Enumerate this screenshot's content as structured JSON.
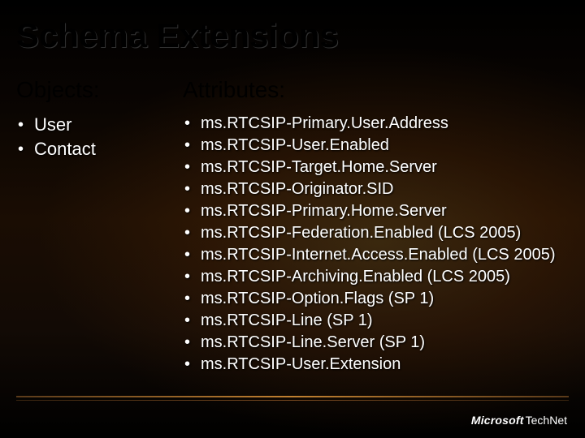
{
  "title": "Schema Extensions",
  "objects": {
    "heading": "Objects:",
    "items": [
      "User",
      "Contact"
    ]
  },
  "attributes": {
    "heading": "Attributes:",
    "items": [
      "ms.RTCSIP-Primary.User.Address",
      "ms.RTCSIP-User.Enabled",
      "ms.RTCSIP-Target.Home.Server",
      "ms.RTCSIP-Originator.SID",
      "ms.RTCSIP-Primary.Home.Server",
      "ms.RTCSIP-Federation.Enabled (LCS 2005)",
      "ms.RTCSIP-Internet.Access.Enabled (LCS 2005)",
      "ms.RTCSIP-Archiving.Enabled (LCS 2005)",
      "ms.RTCSIP-Option.Flags (SP 1)",
      "ms.RTCSIP-Line (SP 1)",
      "ms.RTCSIP-Line.Server (SP 1)",
      "ms.RTCSIP-User.Extension"
    ]
  },
  "footer": {
    "brand": "Microsoft",
    "sub": "TechNet"
  }
}
